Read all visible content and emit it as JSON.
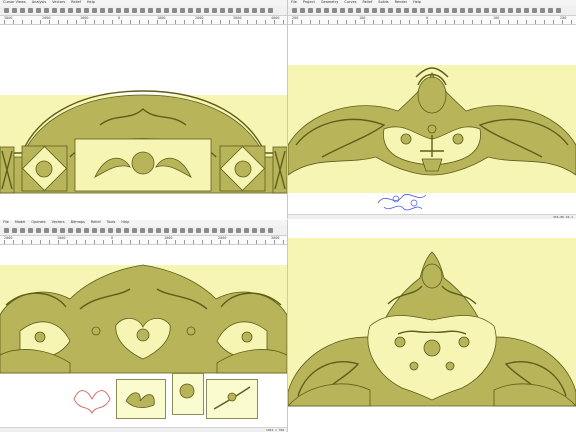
{
  "panes": {
    "top_left": {
      "menu": [
        "Cursor Views",
        "Analysis",
        "Vectors",
        "Relief",
        "Help"
      ],
      "ruler_labels": [
        "3000",
        "2000",
        "1000",
        "0",
        "1000",
        "2000",
        "3000",
        "4000"
      ]
    },
    "top_right": {
      "menu": [
        "File",
        "Project",
        "Geometry",
        "Curves",
        "Relief",
        "Solids",
        "Render",
        "Help"
      ],
      "ruler_labels": [
        "200",
        "100",
        "0",
        "100",
        "200"
      ],
      "status": "256.80 44.1"
    },
    "bottom_left": {
      "menu": [
        "File",
        "Model",
        "Operate",
        "Vectors",
        "Bitmaps",
        "Relief",
        "Tools",
        "Help"
      ],
      "ruler_labels": [
        "2000",
        "1000",
        "0",
        "1000",
        "2000",
        "3000"
      ],
      "status": "1024 × 768"
    },
    "bottom_right": {
      "menu": []
    }
  },
  "colors": {
    "relief_bg": "#f6f5b4",
    "relief_fill": "#b7b45a",
    "relief_stroke": "#5e5e1a",
    "vector_blue": "#4a5ed8",
    "vector_red": "#d84a4a"
  }
}
